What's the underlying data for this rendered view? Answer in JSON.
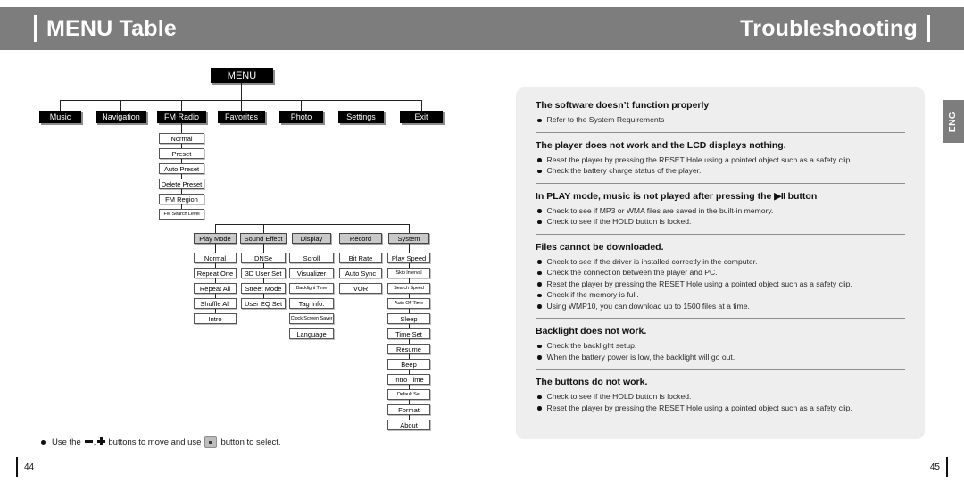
{
  "header": {
    "left_title": "MENU Table",
    "right_title": "Troubleshooting"
  },
  "side_tab": {
    "label": "ENG"
  },
  "page_numbers": {
    "left": "44",
    "right": "45"
  },
  "menu_tree": {
    "root": "MENU",
    "level1": [
      {
        "label": "Music"
      },
      {
        "label": "Navigation"
      },
      {
        "label": "FM Radio"
      },
      {
        "label": "Favorites"
      },
      {
        "label": "Photo"
      },
      {
        "label": "Settings"
      },
      {
        "label": "Exit"
      }
    ],
    "fm_radio_items": [
      "Normal",
      "Preset",
      "Auto Preset",
      "Delete Preset",
      "FM Region",
      "FM Search Level"
    ],
    "settings_columns": [
      {
        "title": "Play Mode",
        "items": [
          "Normal",
          "Repeat One",
          "Repeat All",
          "Shuffle All",
          "Intro"
        ]
      },
      {
        "title": "Sound Effect",
        "items": [
          "DNSe",
          "3D User Set",
          "Street Mode",
          "User EQ Set"
        ]
      },
      {
        "title": "Display",
        "items": [
          "Scroll",
          "Visualizer",
          "Backlight Time",
          "Tag Info.",
          "Clock Screen Saver",
          "Language"
        ]
      },
      {
        "title": "Record",
        "items": [
          "Bit Rate",
          "Auto Sync",
          "VOR"
        ]
      },
      {
        "title": "System",
        "items": [
          "Play Speed",
          "Skip Interval",
          "Search Speed",
          "Auto Off Time",
          "Sleep",
          "Time Set",
          "Resume",
          "Beep",
          "Intro Time",
          "Default Set",
          "Format",
          "About"
        ]
      }
    ]
  },
  "footer_note": {
    "prefix": "Use the",
    "middle": "buttons to move and use",
    "suffix": "button to select."
  },
  "troubleshooting": {
    "groups": [
      {
        "heading": "The software doesn’t function properly",
        "items": [
          "Refer to the System Requirements"
        ]
      },
      {
        "heading": "The player does not work and the LCD displays nothing.",
        "items": [
          "Reset the player by pressing the RESET Hole using a pointed object such as a safety clip.",
          "Check the battery charge status of the player."
        ]
      },
      {
        "heading_pre": "In PLAY mode, music is not played after pressing the",
        "heading_icon": "▶II",
        "heading_post": "button",
        "items": [
          "Check to see if MP3 or WMA  files are saved in the built-in memory.",
          "Check to see if the HOLD button is locked."
        ]
      },
      {
        "heading": "Files cannot be downloaded.",
        "items": [
          "Check to see if the driver is installed correctly in the computer.",
          "Check the connection between the player and PC.",
          "Reset the player by pressing the RESET Hole using a pointed object such as a safety clip.",
          "Check if the memory is full.",
          "Using WMP10, you can download up to 1500 files at a time."
        ]
      },
      {
        "heading": "Backlight does not work.",
        "items": [
          "Check the backlight setup.",
          "When the battery power is low, the backlight will go out."
        ]
      },
      {
        "heading": "The buttons do not work.",
        "items": [
          "Check to see if the HOLD button is locked.",
          "Reset the player by pressing the RESET Hole using a pointed object such as a safety clip."
        ]
      }
    ]
  },
  "colors": {
    "header_gray": "#7d7d7d",
    "panel_gray": "#eeeeee",
    "node_black": "#000000",
    "node_gray": "#c9c9c9"
  }
}
